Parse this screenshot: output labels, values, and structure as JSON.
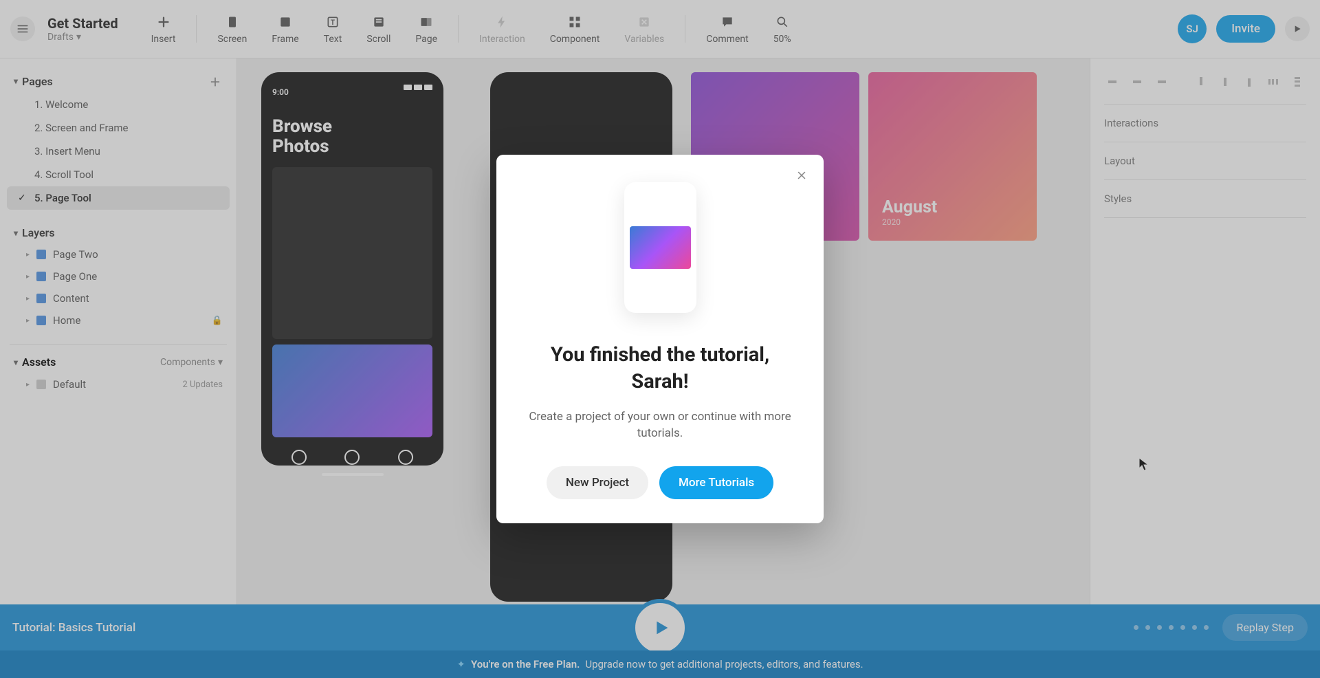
{
  "header": {
    "title": "Get Started",
    "subtitle": "Drafts"
  },
  "tools": {
    "insert": "Insert",
    "screen": "Screen",
    "frame": "Frame",
    "text": "Text",
    "scroll": "Scroll",
    "page": "Page",
    "interaction": "Interaction",
    "component": "Component",
    "variables": "Variables",
    "comment": "Comment",
    "zoom": "50%"
  },
  "user": {
    "initials": "SJ",
    "invite": "Invite"
  },
  "left": {
    "pages_label": "Pages",
    "pages": [
      {
        "label": "1. Welcome"
      },
      {
        "label": "2. Screen and Frame"
      },
      {
        "label": "3. Insert Menu"
      },
      {
        "label": "4. Scroll Tool"
      },
      {
        "label": "5. Page Tool"
      }
    ],
    "layers_label": "Layers",
    "layers": [
      {
        "label": "Page Two"
      },
      {
        "label": "Page One"
      },
      {
        "label": "Content"
      },
      {
        "label": "Home"
      }
    ],
    "assets_label": "Assets",
    "assets_filter": "Components",
    "assets": [
      {
        "label": "Default",
        "updates": "2 Updates"
      }
    ]
  },
  "canvas": {
    "browse_title1": "Browse",
    "browse_title2": "Photos",
    "time": "9:00",
    "card2_month": "August",
    "card2_year": "2020"
  },
  "right": {
    "interactions": "Interactions",
    "layout": "Layout",
    "styles": "Styles"
  },
  "tutorial": {
    "label": "Tutorial: Basics Tutorial",
    "replay": "Replay Step"
  },
  "promo": {
    "bold": "You're on the Free Plan.",
    "rest": "Upgrade now to get additional projects, editors, and features."
  },
  "modal": {
    "heading": "You finished the tutorial, Sarah!",
    "body": "Create a project of your own or continue with more tutorials.",
    "btn_secondary": "New Project",
    "btn_primary": "More Tutorials"
  }
}
